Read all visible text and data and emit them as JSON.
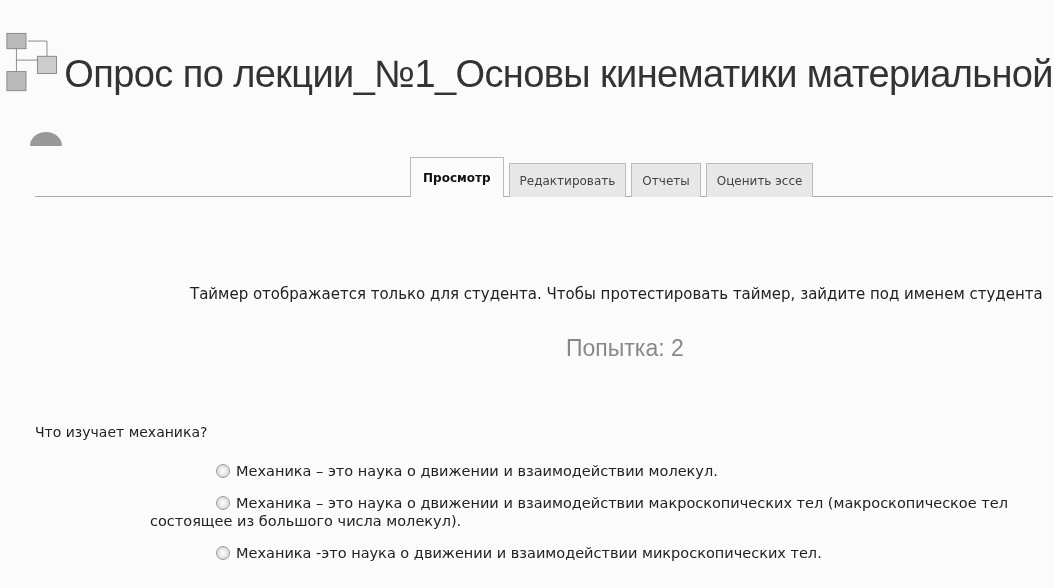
{
  "title": "Опрос по лекции_№1_Основы кинематики материальной",
  "tabs": [
    {
      "label": "Просмотр",
      "selected": true
    },
    {
      "label": "Редактировать",
      "selected": false
    },
    {
      "label": "Отчеты",
      "selected": false
    },
    {
      "label": "Оценить эссе",
      "selected": false
    }
  ],
  "timer_notice": "Таймер отображается только для студента. Чтобы протестировать таймер, зайдите под именем студента",
  "attempt": "Попытка: 2",
  "question": {
    "text": "Что изучает механика?",
    "options": [
      {
        "lines": [
          "Механика – это наука о движении и взаимодействии молекул."
        ],
        "selected": false
      },
      {
        "lines": [
          "Механика – это наука о движении и взаимодействии макроскопических тел (макроскопическое тел",
          "состоящее из большого числа молекул)."
        ],
        "selected": false
      },
      {
        "lines": [
          "Механика -это наука о движении и взаимодействии микроскопических тел."
        ],
        "selected": false
      }
    ]
  }
}
